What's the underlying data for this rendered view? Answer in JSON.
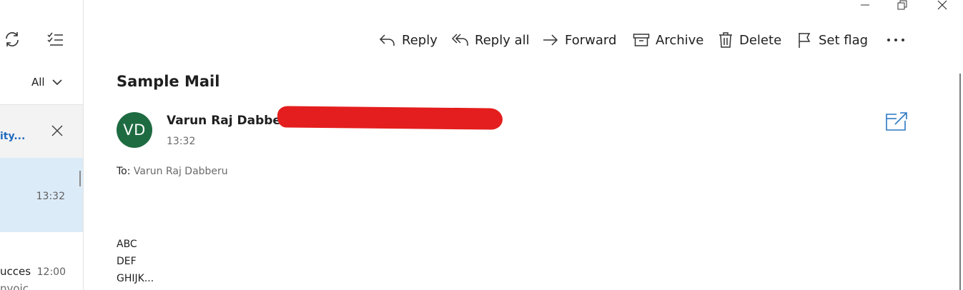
{
  "window": {
    "minimize_icon": "minimize-icon",
    "restore_icon": "restore-icon",
    "close_icon": "close-icon"
  },
  "list_pane": {
    "sync_icon": "sync-icon",
    "select_icon": "select-mode-icon",
    "filter_label": "All",
    "items": [
      {
        "subject_fragment": "ity...",
        "accent_color": "#1f6bbf"
      },
      {
        "time": "13:32"
      },
      {
        "subject_fragment": "ucces",
        "time": "12:00",
        "preview_fragment": "nvoic"
      }
    ]
  },
  "toolbar": {
    "reply": "Reply",
    "reply_all": "Reply all",
    "forward": "Forward",
    "archive": "Archive",
    "delete": "Delete",
    "set_flag": "Set flag",
    "more_icon": "more-icon"
  },
  "message": {
    "subject": "Sample Mail",
    "avatar_initials": "VD",
    "avatar_color": "#1e6b41",
    "sender_name": "Varun Raj Dabberu",
    "time": "13:32",
    "to_label": "To:",
    "to_value": "Varun Raj Dabberu",
    "body": [
      "ABC",
      "DEF",
      "GHIJK..."
    ]
  }
}
